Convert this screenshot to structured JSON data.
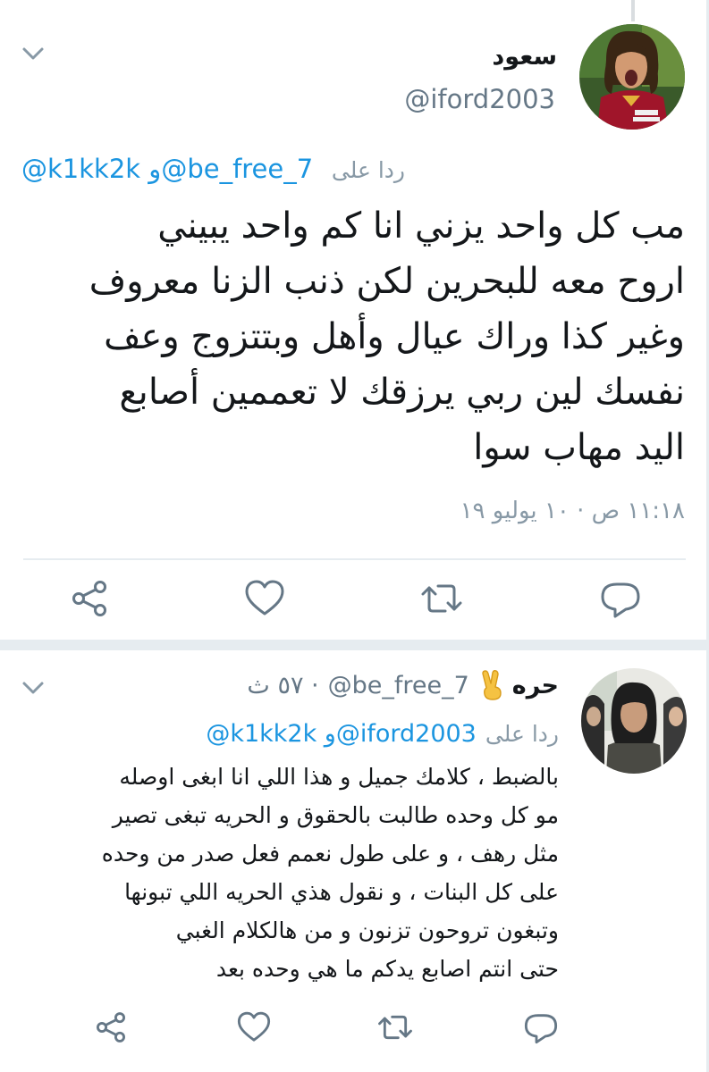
{
  "colors": {
    "link": "#1b95e0",
    "text": "#14171a",
    "secondary": "#657786",
    "muted": "#8899a6",
    "icon": "#657786",
    "divider": "#e6ecf0"
  },
  "main_tweet": {
    "display_name": "سعود",
    "handle": "@iford2003",
    "reply_to_label": "ردا على",
    "reply_to_handles": "@k1kk2k و@be_free_7",
    "body": "مب كل واحد يزني انا كم واحد يبيني\nاروح معه للبحرين لكن ذنب الزنا معروف\nوغير كذا وراك عيال وأهل وبتتزوج وعف\nنفسك لين ربي يرزقك لا تعممين أصابع\nاليد مهاب سوا",
    "timestamp": "١١:١٨ ص · ١٠ يوليو ١٩",
    "actions": [
      "share-icon",
      "heart-icon",
      "retweet-icon",
      "reply-icon"
    ]
  },
  "reply_tweet": {
    "display_name": "حره",
    "emoji": "victory-hand-emoji",
    "handle": "@be_free_7",
    "time": "· ٥٧ ث",
    "reply_to_label": "ردا على",
    "reply_to_handles": "@k1kk2k و@iford2003",
    "body": "بالضبط ، كلامك جميل و هذا اللي انا ابغى اوصله\nمو كل وحده طالبت بالحقوق و الحريه تبغى تصير\nمثل رهف ، و على طول نعمم فعل صدر من وحده\nعلى كل البنات ، و نقول هذي الحريه اللي تبونها\nوتبغون تروحون تزنون و من هالكلام الغبي\nحتى انتم اصابع يدكم ما هي وحده بعد",
    "actions": [
      "reply-icon",
      "retweet-icon",
      "heart-icon",
      "share-icon"
    ]
  }
}
